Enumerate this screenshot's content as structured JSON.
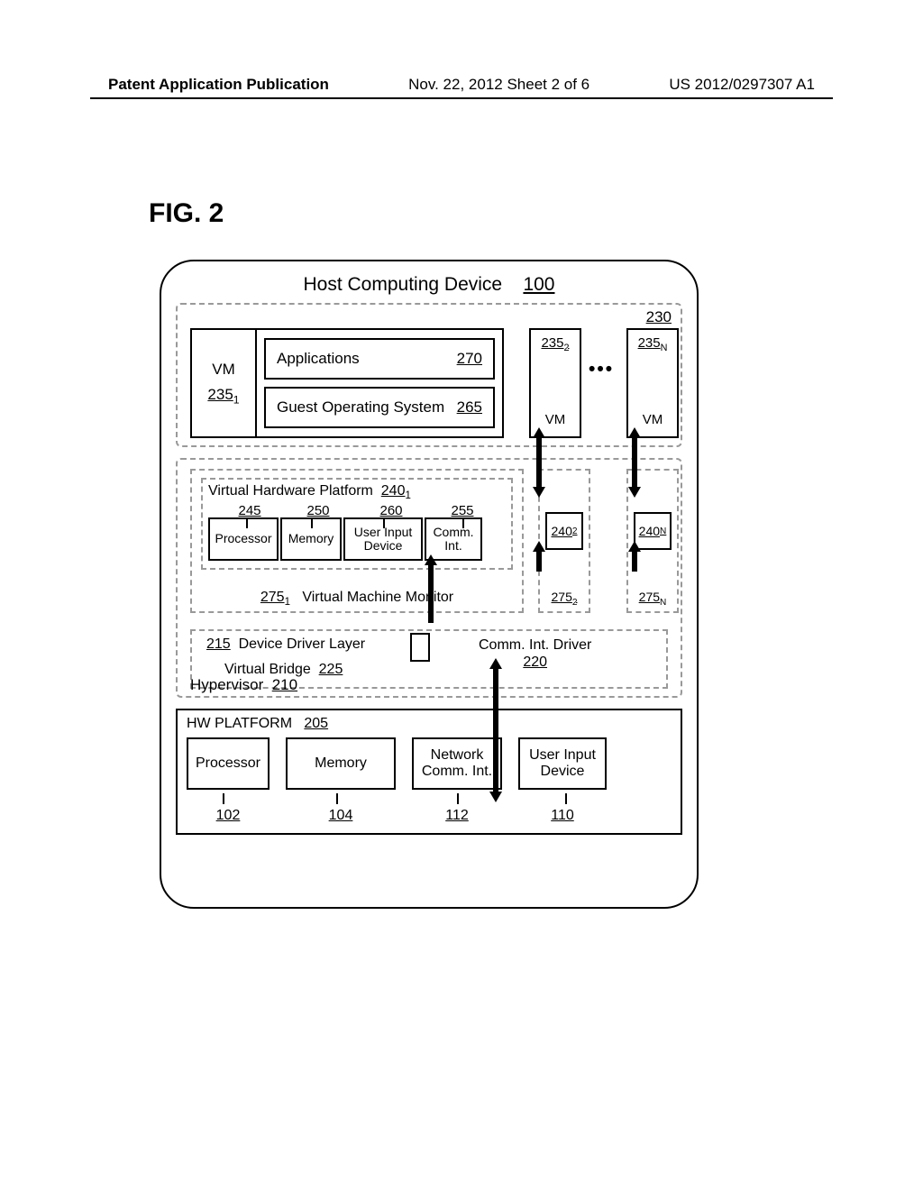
{
  "header": {
    "left": "Patent Application Publication",
    "center": "Nov. 22, 2012  Sheet 2 of 6",
    "right": "US 2012/0297307 A1"
  },
  "figure_label": "FIG. 2",
  "host": {
    "title": "Host Computing Device",
    "ref": "100"
  },
  "vm_group_ref": "230",
  "vm1": {
    "label": "VM",
    "ref": "235",
    "sub": "1",
    "apps": {
      "label": "Applications",
      "ref": "270"
    },
    "gos": {
      "label": "Guest Operating System",
      "ref": "265"
    }
  },
  "vm2": {
    "label": "VM",
    "ref": "235",
    "sub": "2"
  },
  "vmN": {
    "label": "VM",
    "ref": "235",
    "sub": "N"
  },
  "dots": "•••",
  "vhw": {
    "title": "Virtual Hardware Platform",
    "ref": "240",
    "sub": "1",
    "cells": {
      "c1": "Processor",
      "c2": "Memory",
      "c3": "User Input Device",
      "c4": "Comm. Int."
    },
    "labels": {
      "l1": "245",
      "l2": "250",
      "l3": "260",
      "l4": "255"
    }
  },
  "vmm1": {
    "ref": "275",
    "sub": "1",
    "label": "Virtual Machine Monitor"
  },
  "vmm2": {
    "plat_ref": "240",
    "plat_sub": "2",
    "ref": "275",
    "sub": "2"
  },
  "vmmN": {
    "plat_ref": "240",
    "plat_sub": "N",
    "ref": "275",
    "sub": "N"
  },
  "ddl": {
    "ref": "215",
    "label": "Device Driver Layer",
    "vb_label": "Virtual Bridge",
    "vb_ref": "225",
    "cint_label": "Comm. Int. Driver",
    "cint_ref": "220"
  },
  "hyp": {
    "label": "Hypervisor",
    "ref": "210"
  },
  "hw": {
    "title": "HW PLATFORM",
    "ref": "205",
    "cells": {
      "p": "Processor",
      "m": "Memory",
      "n": "Network Comm. Int.",
      "u": "User Input Device"
    },
    "labels": {
      "p": "102",
      "m": "104",
      "n": "112",
      "u": "110"
    }
  },
  "chart_data": {
    "type": "diagram",
    "title": "FIG. 2 – Host Computing Device 100 architecture",
    "nodes": [
      {
        "id": "100",
        "name": "Host Computing Device"
      },
      {
        "id": "230",
        "name": "VM group"
      },
      {
        "id": "235_1",
        "name": "VM 235₁",
        "children": [
          {
            "id": "270",
            "name": "Applications"
          },
          {
            "id": "265",
            "name": "Guest Operating System"
          }
        ]
      },
      {
        "id": "235_2",
        "name": "VM 235₂"
      },
      {
        "id": "235_N",
        "name": "VM 235_N"
      },
      {
        "id": "210",
        "name": "Hypervisor",
        "children": [
          {
            "id": "275_1",
            "name": "Virtual Machine Monitor 275₁",
            "children": [
              {
                "id": "240_1",
                "name": "Virtual Hardware Platform 240₁",
                "children": [
                  {
                    "id": "245",
                    "name": "Processor"
                  },
                  {
                    "id": "250",
                    "name": "Memory"
                  },
                  {
                    "id": "260",
                    "name": "User Input Device"
                  },
                  {
                    "id": "255",
                    "name": "Comm. Int."
                  }
                ]
              }
            ]
          },
          {
            "id": "275_2",
            "name": "VMM 275₂",
            "children": [
              {
                "id": "240_2",
                "name": "Platform 240₂"
              }
            ]
          },
          {
            "id": "275_N",
            "name": "VMM 275_N",
            "children": [
              {
                "id": "240_N",
                "name": "Platform 240_N"
              }
            ]
          },
          {
            "id": "215",
            "name": "Device Driver Layer",
            "children": [
              {
                "id": "225",
                "name": "Virtual Bridge"
              },
              {
                "id": "220",
                "name": "Comm. Int. Driver"
              }
            ]
          }
        ]
      },
      {
        "id": "205",
        "name": "HW PLATFORM",
        "children": [
          {
            "id": "102",
            "name": "Processor"
          },
          {
            "id": "104",
            "name": "Memory"
          },
          {
            "id": "112",
            "name": "Network Comm. Int."
          },
          {
            "id": "110",
            "name": "User Input Device"
          }
        ]
      }
    ],
    "edges": [
      {
        "from": "235_2",
        "to": "240_2",
        "bidirectional": true
      },
      {
        "from": "235_N",
        "to": "240_N",
        "bidirectional": true
      },
      {
        "from": "255",
        "to": "225"
      },
      {
        "from": "225",
        "to": "220"
      },
      {
        "from": "220",
        "to": "112"
      },
      {
        "from": "240_2",
        "to": "275_2"
      },
      {
        "from": "240_N",
        "to": "275_N"
      }
    ]
  }
}
